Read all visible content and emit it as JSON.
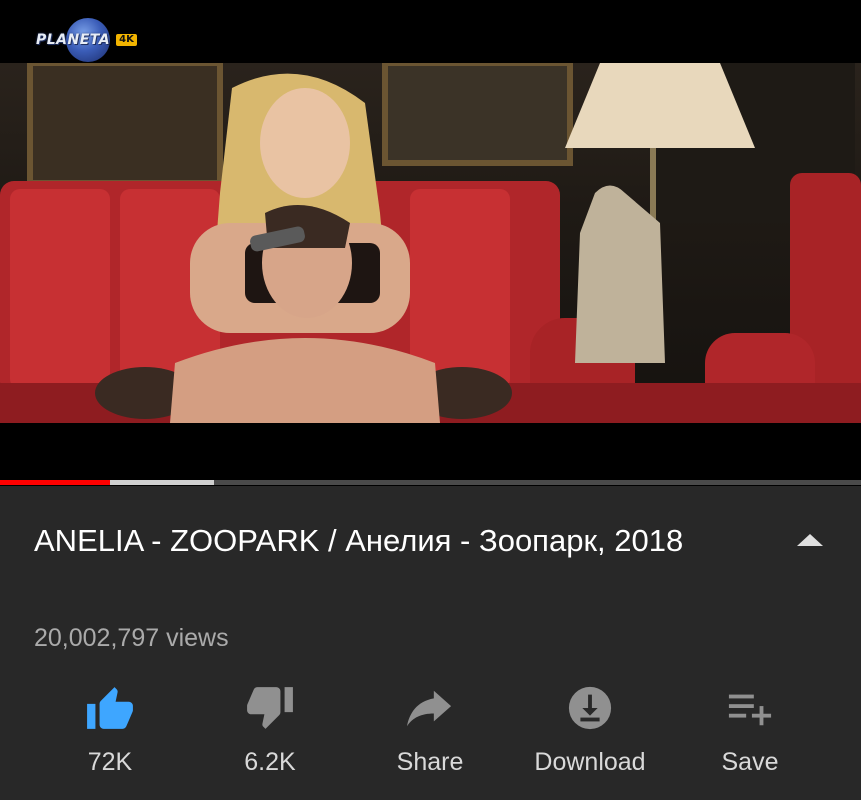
{
  "player": {
    "logo_text": "PLANETA",
    "logo_badge": "4K",
    "progress": {
      "played_fraction": 0.128,
      "buffered_fraction": 0.248
    }
  },
  "video": {
    "title": "ANELIA - ZOOPARK / Анелия - Зоопарк, 2018",
    "views": "20,002,797 views"
  },
  "actions": [
    {
      "id": "like",
      "label": "72K",
      "icon": "thumbs-up-icon",
      "color": "#3ea6ff"
    },
    {
      "id": "dislike",
      "label": "6.2K",
      "icon": "thumbs-down-icon",
      "color": "#909090"
    },
    {
      "id": "share",
      "label": "Share",
      "icon": "share-icon",
      "color": "#909090"
    },
    {
      "id": "download",
      "label": "Download",
      "icon": "download-icon",
      "color": "#909090"
    },
    {
      "id": "save",
      "label": "Save",
      "icon": "playlist-add-icon",
      "color": "#909090"
    }
  ],
  "colors": {
    "accent_red": "#ff0000",
    "like_blue": "#3ea6ff",
    "background": "#282828"
  }
}
